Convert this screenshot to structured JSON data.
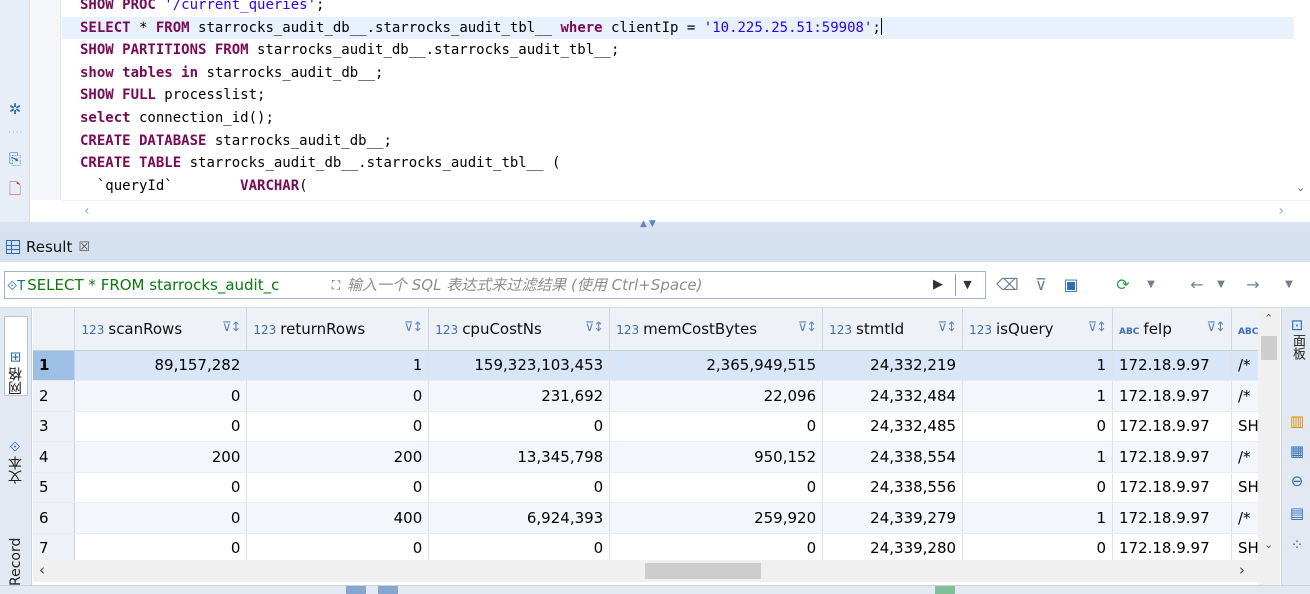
{
  "editor": {
    "lines": [
      {
        "parts": [
          {
            "c": "kw",
            "t": "SHOW PROC "
          },
          {
            "c": "str",
            "t": "'/current_queries'"
          },
          {
            "c": "plain",
            "t": ";"
          }
        ]
      },
      {
        "active": true,
        "parts": [
          {
            "c": "kw",
            "t": "SELECT"
          },
          {
            "c": "plain",
            "t": " * "
          },
          {
            "c": "kw",
            "t": "FROM"
          },
          {
            "c": "plain",
            "t": " starrocks_audit_db__.starrocks_audit_tbl__ "
          },
          {
            "c": "kw",
            "t": "where"
          },
          {
            "c": "plain",
            "t": " clientIp = "
          },
          {
            "c": "str",
            "t": "'10.225.25.51:59908'"
          },
          {
            "c": "plain",
            "t": ";"
          }
        ]
      },
      {
        "parts": [
          {
            "c": "kw",
            "t": "SHOW PARTITIONS FROM"
          },
          {
            "c": "plain",
            "t": " starrocks_audit_db__.starrocks_audit_tbl__;"
          }
        ]
      },
      {
        "parts": [
          {
            "c": "kw",
            "t": "show"
          },
          {
            "c": "plain",
            "t": " "
          },
          {
            "c": "kw",
            "t": "tables"
          },
          {
            "c": "plain",
            "t": " "
          },
          {
            "c": "kw",
            "t": "in"
          },
          {
            "c": "plain",
            "t": " starrocks_audit_db__;"
          }
        ]
      },
      {
        "parts": [
          {
            "c": "kw",
            "t": "SHOW FULL"
          },
          {
            "c": "plain",
            "t": " processlist;"
          }
        ]
      },
      {
        "parts": [
          {
            "c": "kw",
            "t": "select"
          },
          {
            "c": "plain",
            "t": " connection_id();"
          }
        ]
      },
      {
        "parts": [
          {
            "c": "kw",
            "t": "CREATE DATABASE"
          },
          {
            "c": "plain",
            "t": " starrocks_audit_db__;"
          }
        ]
      },
      {
        "parts": [
          {
            "c": "kw",
            "t": "CREATE TABLE"
          },
          {
            "c": "plain",
            "t": " starrocks_audit_db__.starrocks_audit_tbl__ ("
          }
        ]
      },
      {
        "parts": [
          {
            "c": "plain",
            "t": "  `queryId`        "
          },
          {
            "c": "kw",
            "t": "VARCHAR"
          },
          {
            "c": "plain",
            "t": "("
          }
        ]
      }
    ]
  },
  "result_tab": {
    "label": "Result",
    "close": "☒"
  },
  "filter": {
    "query_text": "SELECT * FROM starrocks_audit_c",
    "placeholder": "输入一个 SQL 表达式来过滤结果 (使用 Ctrl+Space)"
  },
  "side_left_tabs": [
    "网格",
    "文本",
    "Record"
  ],
  "side_right_label": "面板",
  "grid": {
    "columns": [
      {
        "type": "123",
        "name": "scanRows"
      },
      {
        "type": "123",
        "name": "returnRows"
      },
      {
        "type": "123",
        "name": "cpuCostNs"
      },
      {
        "type": "123",
        "name": "memCostBytes"
      },
      {
        "type": "123",
        "name": "stmtId"
      },
      {
        "type": "123",
        "name": "isQuery"
      },
      {
        "type": "ABC",
        "name": "feIp"
      },
      {
        "type": "ABC",
        "name": ""
      }
    ],
    "rows": [
      {
        "n": "1",
        "cells": [
          "89,157,282",
          "1",
          "159,323,103,453",
          "2,365,949,515",
          "24,332,219",
          "1",
          "172.18.9.97",
          "/*"
        ]
      },
      {
        "n": "2",
        "cells": [
          "0",
          "0",
          "231,692",
          "22,096",
          "24,332,484",
          "1",
          "172.18.9.97",
          "/*"
        ]
      },
      {
        "n": "3",
        "cells": [
          "0",
          "0",
          "0",
          "0",
          "24,332,485",
          "0",
          "172.18.9.97",
          "SH"
        ]
      },
      {
        "n": "4",
        "cells": [
          "200",
          "200",
          "13,345,798",
          "950,152",
          "24,338,554",
          "1",
          "172.18.9.97",
          "/*"
        ]
      },
      {
        "n": "5",
        "cells": [
          "0",
          "0",
          "0",
          "0",
          "24,338,556",
          "0",
          "172.18.9.97",
          "SH"
        ]
      },
      {
        "n": "6",
        "cells": [
          "0",
          "400",
          "6,924,393",
          "259,920",
          "24,339,279",
          "1",
          "172.18.9.97",
          "/*"
        ]
      },
      {
        "n": "7",
        "cells": [
          "0",
          "0",
          "0",
          "0",
          "24,339,280",
          "0",
          "172.18.9.97",
          "SH"
        ]
      }
    ]
  },
  "colors": {
    "accent": "#2d6db5",
    "keyword": "#7a0a55",
    "string": "#2a00ff",
    "selected_row": "#d8e6f8"
  }
}
